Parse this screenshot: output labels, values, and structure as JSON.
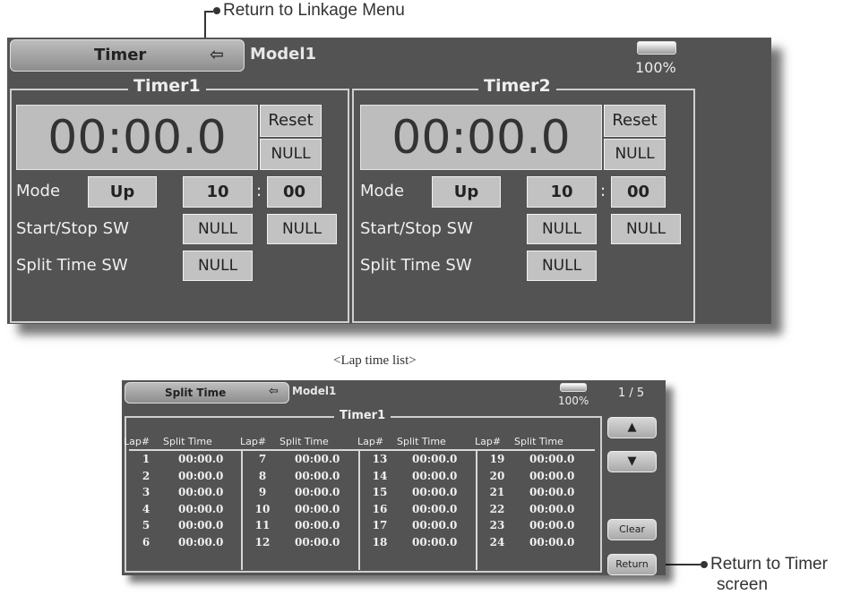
{
  "callouts": {
    "linkage": "Return to Linkage Menu",
    "return_timer_line1": "Return to Timer",
    "return_timer_line2": "screen",
    "lap_list_caption": "<Lap time list>"
  },
  "timer_screen": {
    "title": "Timer",
    "model": "Model1",
    "battery": "100%",
    "battery_level": 1.0,
    "timers": [
      {
        "name": "Timer1",
        "display": "00:00.0",
        "reset_label": "Reset",
        "reset_sw": "NULL",
        "mode_label": "Mode",
        "mode": "Up",
        "minutes": "10",
        "colon": ":",
        "seconds": "00",
        "start_stop_label": "Start/Stop SW",
        "start_sw": "NULL",
        "stop_sw": "NULL",
        "split_label": "Split Time SW",
        "split_sw": "NULL"
      },
      {
        "name": "Timer2",
        "display": "00:00.0",
        "reset_label": "Reset",
        "reset_sw": "NULL",
        "mode_label": "Mode",
        "mode": "Up",
        "minutes": "10",
        "colon": ":",
        "seconds": "00",
        "start_stop_label": "Start/Stop SW",
        "start_sw": "NULL",
        "stop_sw": "NULL",
        "split_label": "Split Time SW",
        "split_sw": "NULL"
      }
    ]
  },
  "split_screen": {
    "title": "Split Time",
    "model": "Model1",
    "battery": "100%",
    "page": "1 / 5",
    "frame_title": "Timer1",
    "col_lap": "Lap#",
    "col_split": "Split Time",
    "laps": [
      [
        "1",
        "00:00.0"
      ],
      [
        "2",
        "00:00.0"
      ],
      [
        "3",
        "00:00.0"
      ],
      [
        "4",
        "00:00.0"
      ],
      [
        "5",
        "00:00.0"
      ],
      [
        "6",
        "00:00.0"
      ],
      [
        "7",
        "00:00.0"
      ],
      [
        "8",
        "00:00.0"
      ],
      [
        "9",
        "00:00.0"
      ],
      [
        "10",
        "00:00.0"
      ],
      [
        "11",
        "00:00.0"
      ],
      [
        "12",
        "00:00.0"
      ],
      [
        "13",
        "00:00.0"
      ],
      [
        "14",
        "00:00.0"
      ],
      [
        "15",
        "00:00.0"
      ],
      [
        "16",
        "00:00.0"
      ],
      [
        "17",
        "00:00.0"
      ],
      [
        "18",
        "00:00.0"
      ],
      [
        "19",
        "00:00.0"
      ],
      [
        "20",
        "00:00.0"
      ],
      [
        "21",
        "00:00.0"
      ],
      [
        "22",
        "00:00.0"
      ],
      [
        "23",
        "00:00.0"
      ],
      [
        "24",
        "00:00.0"
      ]
    ],
    "up_icon": "up-arrow-icon",
    "down_icon": "down-arrow-icon",
    "clear_label": "Clear",
    "return_label": "Return"
  }
}
